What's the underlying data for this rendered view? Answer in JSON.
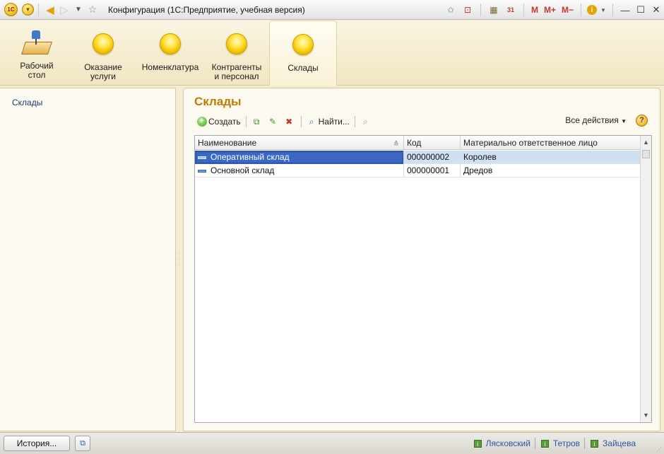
{
  "window": {
    "title": "Конфигурация  (1С:Предприятие, учебная версия)",
    "logo_text": "1С"
  },
  "titlebar": {
    "right_m": "M",
    "right_mplus": "M+",
    "right_mminus": "M−",
    "calendar_text": "31"
  },
  "sections": [
    {
      "label_line1": "Рабочий",
      "label_line2": "стол",
      "icon": "desktop-icon"
    },
    {
      "label_line1": "Оказание",
      "label_line2": "услуги",
      "icon": "section-orb-icon"
    },
    {
      "label_line1": "Номенклатура",
      "label_line2": "",
      "icon": "section-orb-icon"
    },
    {
      "label_line1": "Контрагенты",
      "label_line2": "и персонал",
      "icon": "section-orb-icon"
    },
    {
      "label_line1": "Склады",
      "label_line2": "",
      "icon": "section-orb-icon",
      "active": true
    }
  ],
  "left_panel": {
    "items": [
      "Склады"
    ]
  },
  "main": {
    "title": "Склады",
    "toolbar": {
      "create_label": "Создать",
      "find_label": "Найти...",
      "all_actions_label": "Все действия",
      "help_label": "?"
    },
    "table": {
      "columns": [
        "Наименование",
        "Код",
        "Материально ответственное лицо"
      ],
      "rows": [
        {
          "name": "Оперативный склад",
          "code": "000000002",
          "person": "Королев",
          "selected": true
        },
        {
          "name": "Основной склад",
          "code": "000000001",
          "person": "Дредов",
          "selected": false
        }
      ]
    }
  },
  "statusbar": {
    "history_label": "История...",
    "users": [
      "Лясковский",
      "Тетров",
      "Зайцева"
    ]
  },
  "colors": {
    "accent_title": "#c07c00",
    "selection": "#3a66c4",
    "row_highlight": "#cfe0f3",
    "panel_bg": "#f4ecd2"
  }
}
